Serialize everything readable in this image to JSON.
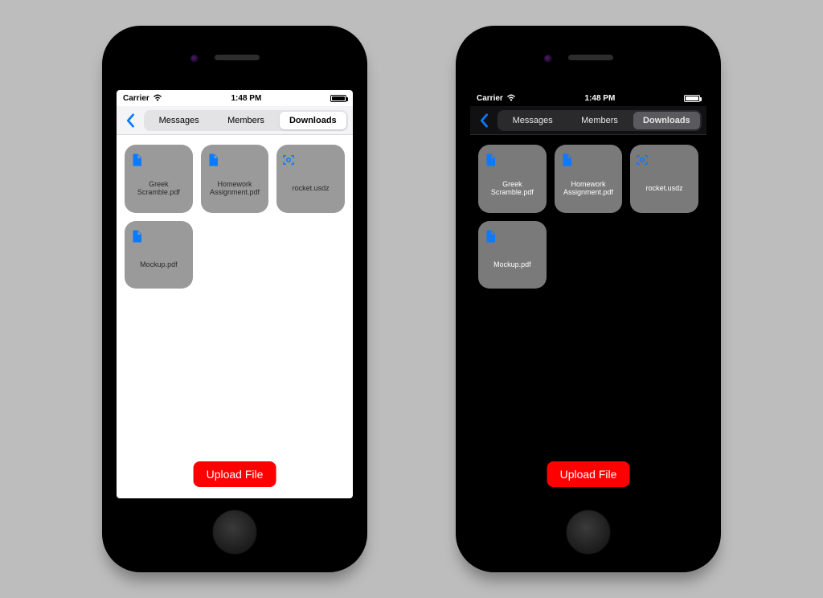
{
  "status": {
    "carrier": "Carrier",
    "time": "1:48 PM"
  },
  "tabs": {
    "items": [
      "Messages",
      "Members",
      "Downloads"
    ],
    "selected_index": 2
  },
  "files": [
    {
      "name": "Greek Scramble.pdf",
      "icon": "doc"
    },
    {
      "name": "Homework Assignment.pdf",
      "icon": "doc"
    },
    {
      "name": "rocket.usdz",
      "icon": "arkit"
    },
    {
      "name": "Mockup.pdf",
      "icon": "doc"
    }
  ],
  "upload_label": "Upload File",
  "colors": {
    "accent_blue": "#0a7aff",
    "upload_red": "#ff0000"
  }
}
